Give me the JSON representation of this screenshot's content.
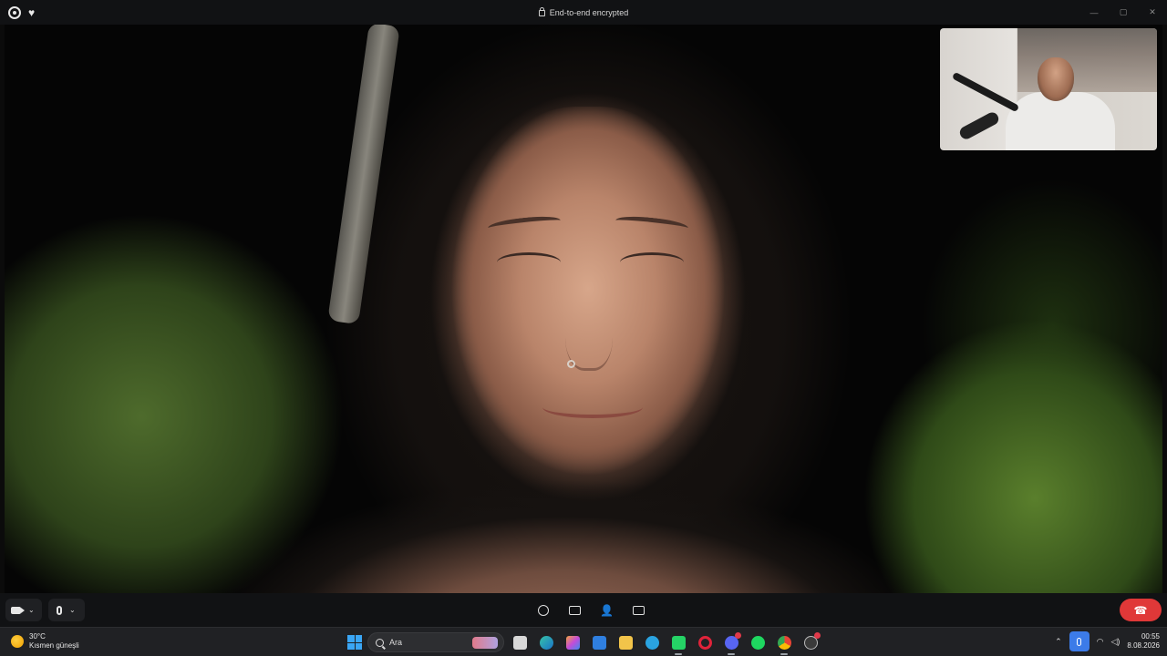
{
  "titlebar": {
    "title": "End-to-end encrypted",
    "controls": {
      "minimize": "—",
      "maximize": "▢",
      "close": "✕"
    }
  },
  "call": {
    "remote_participant": "main-video",
    "self_view": "pip-video",
    "end_call_icon": "phone-hangup-icon",
    "accent_end": "#e03838"
  },
  "taskbar": {
    "weather": {
      "temp": "30°C",
      "condition": "Kısmen güneşli"
    },
    "search": {
      "placeholder": "Ara"
    },
    "clock": {
      "time": "00:55",
      "date": "8.08.2026"
    },
    "apps": [
      "file-explorer-icon",
      "edge-icon",
      "copilot-icon",
      "outlook-icon",
      "folder-icon",
      "telegram-icon",
      "whatsapp-icon",
      "opera-icon",
      "discord-icon",
      "spotify-icon",
      "chrome-icon",
      "obs-icon"
    ]
  }
}
